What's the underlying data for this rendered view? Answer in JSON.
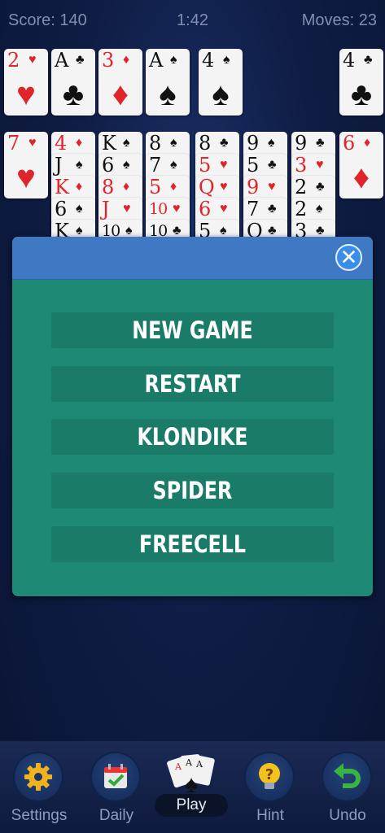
{
  "header": {
    "score": "Score: 140",
    "time": "1:42",
    "moves": "Moves: 23"
  },
  "foundations": [
    {
      "rank": "2",
      "suit": "♥",
      "color": "red"
    },
    {
      "rank": "A",
      "suit": "♣",
      "color": "blk"
    },
    {
      "rank": "3",
      "suit": "♦",
      "color": "red"
    },
    {
      "rank": "A",
      "suit": "♠",
      "color": "blk"
    },
    {
      "rank": "4",
      "suit": "♠",
      "color": "blk"
    },
    {
      "rank": "4",
      "suit": "♣",
      "color": "blk"
    }
  ],
  "tableau_top": [
    [
      {
        "rank": "7",
        "suit": "♥",
        "color": "red"
      }
    ],
    [
      {
        "rank": "4",
        "suit": "♦",
        "color": "red"
      },
      {
        "rank": "J",
        "suit": "♠",
        "color": "blk"
      },
      {
        "rank": "K",
        "suit": "♦",
        "color": "red"
      },
      {
        "rank": "6",
        "suit": "♠",
        "color": "blk"
      },
      {
        "rank": "K",
        "suit": "♠",
        "color": "blk"
      }
    ],
    [
      {
        "rank": "K",
        "suit": "♠",
        "color": "blk"
      },
      {
        "rank": "6",
        "suit": "♠",
        "color": "blk"
      },
      {
        "rank": "8",
        "suit": "♦",
        "color": "red"
      },
      {
        "rank": "J",
        "suit": "♥",
        "color": "red"
      },
      {
        "rank": "10",
        "suit": "♠",
        "color": "blk"
      }
    ],
    [
      {
        "rank": "8",
        "suit": "♠",
        "color": "blk"
      },
      {
        "rank": "7",
        "suit": "♠",
        "color": "blk"
      },
      {
        "rank": "5",
        "suit": "♦",
        "color": "red"
      },
      {
        "rank": "10",
        "suit": "♥",
        "color": "red"
      },
      {
        "rank": "10",
        "suit": "♣",
        "color": "blk"
      }
    ],
    [
      {
        "rank": "8",
        "suit": "♣",
        "color": "blk"
      },
      {
        "rank": "5",
        "suit": "♥",
        "color": "red"
      },
      {
        "rank": "Q",
        "suit": "♥",
        "color": "red"
      },
      {
        "rank": "6",
        "suit": "♥",
        "color": "red"
      },
      {
        "rank": "5",
        "suit": "♠",
        "color": "blk"
      }
    ],
    [
      {
        "rank": "9",
        "suit": "♠",
        "color": "blk"
      },
      {
        "rank": "5",
        "suit": "♣",
        "color": "blk"
      },
      {
        "rank": "9",
        "suit": "♥",
        "color": "red"
      },
      {
        "rank": "7",
        "suit": "♣",
        "color": "blk"
      },
      {
        "rank": "Q",
        "suit": "♣",
        "color": "blk"
      }
    ],
    [
      {
        "rank": "9",
        "suit": "♣",
        "color": "blk"
      },
      {
        "rank": "3",
        "suit": "♥",
        "color": "red"
      },
      {
        "rank": "2",
        "suit": "♣",
        "color": "blk"
      },
      {
        "rank": "2",
        "suit": "♠",
        "color": "blk"
      },
      {
        "rank": "3",
        "suit": "♣",
        "color": "blk"
      }
    ],
    [
      {
        "rank": "6",
        "suit": "♦",
        "color": "red"
      }
    ]
  ],
  "menu": {
    "close_icon": "close-icon",
    "items": [
      "NEW GAME",
      "RESTART",
      "KLONDIKE",
      "SPIDER",
      "FREECELL"
    ]
  },
  "bottom_nav": {
    "settings": {
      "label": "Settings",
      "icon": "gear-icon"
    },
    "daily": {
      "label": "Daily",
      "icon": "calendar-icon"
    },
    "play": {
      "label": "Play",
      "icon": "cards-icon"
    },
    "hint": {
      "label": "Hint",
      "icon": "lightbulb-icon"
    },
    "undo": {
      "label": "Undo",
      "icon": "undo-icon"
    }
  },
  "colors": {
    "menu_bg": "#1e8a76",
    "menu_header": "#3f79c4",
    "card_red": "#e0242b"
  }
}
